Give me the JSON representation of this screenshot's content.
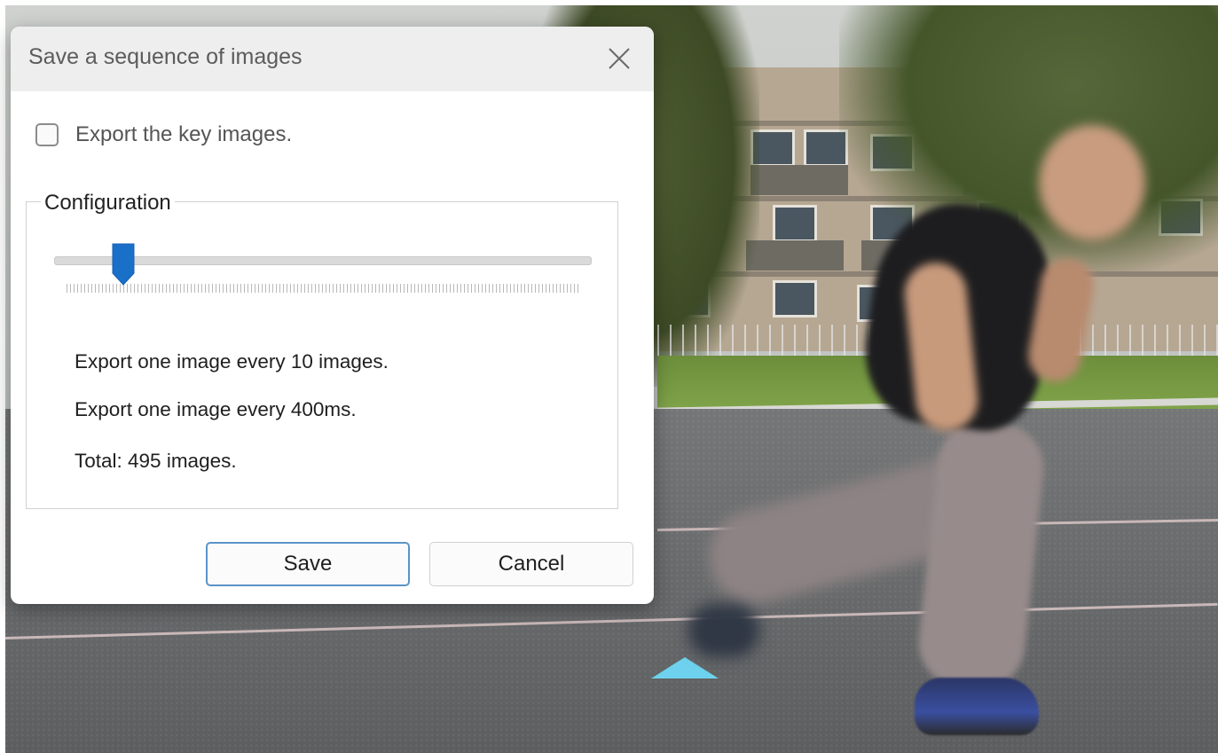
{
  "dialog": {
    "title": "Save a sequence of images",
    "close_icon": "close-icon",
    "export_key_images": {
      "label": "Export the key images.",
      "checked": false
    },
    "configuration": {
      "legend": "Configuration",
      "slider": {
        "value_fraction": 0.09,
        "accent_color": "#1a6fc9"
      },
      "interval_images_text": "Export one image every 10 images.",
      "interval_time_text": "Export one image every 400ms.",
      "total_text": "Total: 495 images."
    },
    "buttons": {
      "save": "Save",
      "cancel": "Cancel"
    }
  }
}
